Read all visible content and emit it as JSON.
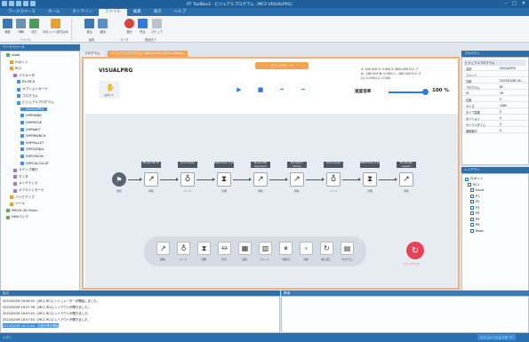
{
  "titlebar": {
    "title": "RT ToolBox3 - ビジュアルプログラム（MC1:VISUALPRG）"
  },
  "menu": [
    {
      "label": "ワークスペース"
    },
    {
      "label": "ホーム"
    },
    {
      "label": "オンライン"
    },
    {
      "label": "ファイル"
    },
    {
      "label": "編集"
    },
    {
      "label": "表示"
    },
    {
      "label": "ヘルプ"
    }
  ],
  "ribbon": {
    "buttons": [
      {
        "label": "保存"
      },
      {
        "label": "印刷"
      },
      {
        "label": "出力"
      },
      {
        "label": "ロボットへ書き込み"
      },
      {
        "label": "書込"
      },
      {
        "label": "読出"
      },
      {
        "label": "実行"
      },
      {
        "label": "停止"
      },
      {
        "label": "ステップ"
      }
    ],
    "groups": [
      "ファイル",
      "編集",
      "モニタ",
      "開始終了"
    ]
  },
  "workspace": {
    "header": "ワークスペース",
    "rows": [
      {
        "label": "robot",
        "indent": 1
      },
      {
        "label": "ロボット",
        "indent": 2
      },
      {
        "label": "RC1",
        "indent": 2
      },
      {
        "label": "パラメータ",
        "indent": 3
      },
      {
        "label": "RV-FR-D",
        "indent": 4
      },
      {
        "label": "オプションカード",
        "indent": 4
      },
      {
        "label": "プログラム",
        "indent": 4
      },
      {
        "label": "ビジュアルプログラム",
        "indent": 4
      },
      {
        "label": "VISUALPRG",
        "indent": 5,
        "selected": true
      },
      {
        "label": "VHPHAND",
        "indent": 5
      },
      {
        "label": "VHPMOVE",
        "indent": 5
      },
      {
        "label": "VHPWAIT",
        "indent": 5
      },
      {
        "label": "VHPBRANCH",
        "indent": 5
      },
      {
        "label": "VHPPALLET",
        "indent": 5
      },
      {
        "label": "VHPSIGNAL",
        "indent": 5
      },
      {
        "label": "VHPVISION",
        "indent": 5
      },
      {
        "label": "VHPCALCULAT",
        "indent": 5
      },
      {
        "label": "ステップ実行",
        "indent": 3
      },
      {
        "label": "モニタ",
        "indent": 3
      },
      {
        "label": "メンテナンス",
        "indent": 3
      },
      {
        "label": "オフラインモード",
        "indent": 3
      },
      {
        "label": "バックアップ",
        "indent": 2
      },
      {
        "label": "ツール",
        "indent": 2
      },
      {
        "label": "MELFA 3D Vision",
        "indent": 1
      },
      {
        "label": "HMI/バンク",
        "indent": 1
      }
    ]
  },
  "tabs": [
    {
      "label": "プログラム"
    },
    {
      "label": "ビジュアルプログラム VISUALPRG (MC1:Offline)"
    }
  ],
  "editor": {
    "program_name": "VISUALPRG",
    "mode_tag": "ステップモード",
    "robot_card_label": "ロボット",
    "coords": [
      "X: 400.000  Y: 0.000  Z: 800.000  FL1: 7",
      "A: -180.000  B: 0.000  C: -180.000  FL2: 0",
      "L1: 0.000  L2: 0.000"
    ],
    "speed_label": "速度倍率",
    "speed_value": "100 %",
    "speed_fraction": 1.0
  },
  "flow": {
    "start_label": "開始",
    "nodes": [
      {
        "title": "Move(LIN) P1",
        "caption": "移動",
        "glyph": "↗"
      },
      {
        "title": "Hand Open",
        "caption": "ハンド",
        "glyph": "♁"
      },
      {
        "title": "Wait(Time) 0.5s",
        "caption": "待機",
        "glyph": "⧗"
      },
      {
        "title": "Move(LIN) Approach",
        "caption": "移動",
        "glyph": "↗"
      },
      {
        "title": "Move(JNT) PickUp",
        "caption": "移動",
        "glyph": "↗"
      },
      {
        "title": "Hand Close",
        "caption": "ハンド",
        "glyph": "♁"
      },
      {
        "title": "Wait(Time) 0.5s",
        "caption": "待機",
        "glyph": "⧗"
      },
      {
        "title": "Move(LIN) Depart",
        "caption": "移動",
        "glyph": "↗"
      }
    ]
  },
  "palette": [
    {
      "label": "移動",
      "glyph": "↗"
    },
    {
      "label": "ハンド",
      "glyph": "♁"
    },
    {
      "label": "待機",
      "glyph": "⧗"
    },
    {
      "label": "信号",
      "glyph": "⏛"
    },
    {
      "label": "演算",
      "glyph": "▦"
    },
    {
      "label": "パレット",
      "glyph": "▥"
    },
    {
      "label": "一時停止",
      "glyph": "⏸"
    },
    {
      "label": "分岐",
      "glyph": "‹"
    },
    {
      "label": "繰り返し",
      "glyph": "↻"
    },
    {
      "label": "プログラム",
      "glyph": "▤"
    }
  ],
  "run_button": {
    "label": "プレイバック"
  },
  "properties": {
    "header": "プロパティ",
    "subheader": "ビジュアルプログラム",
    "rows": [
      {
        "k": "名前",
        "v": "VISUALPRG"
      },
      {
        "k": "コメント",
        "v": ""
      },
      {
        "k": "日時",
        "v": "2023/02/08 16:..."
      },
      {
        "k": "プログラム",
        "v": "BC"
      },
      {
        "k": "ID",
        "v": "16"
      },
      {
        "k": "位置",
        "v": "0"
      },
      {
        "k": "サイズ",
        "v": "1080"
      },
      {
        "k": "タイプ変数",
        "v": "0"
      },
      {
        "k": "ポジション",
        "v": "0"
      },
      {
        "k": "サイクルタイム",
        "v": "0"
      },
      {
        "k": "連続実行",
        "v": "0"
      }
    ]
  },
  "layout_panel": {
    "header": "レイアウト",
    "rows": [
      {
        "label": "ロボット"
      },
      {
        "label": "RC1"
      },
      {
        "label": "hand"
      },
      {
        "label": "P1"
      },
      {
        "label": "P2"
      },
      {
        "label": "P3"
      },
      {
        "label": "P4"
      },
      {
        "label": "P5"
      },
      {
        "label": "P6"
      },
      {
        "label": "Base"
      }
    ]
  },
  "output": {
    "header": "出力",
    "header2": "検索",
    "rows": [
      {
        "text": "2023/02/08 16:06:55 : [MC1 RC1] シミュレーターが開始しました。"
      },
      {
        "text": "2023/02/08 16:07:38 : [MC1 RC1] レイアウトが開きました。"
      },
      {
        "text": "2023/02/08 16:07:42 : [MC1 RC1] レイアウトが開きました。"
      },
      {
        "text": "2023/02/08 16:07:50 : [MC1 RC1] レイアウトが開きました。"
      },
      {
        "text": "2023/02/08 16:11:48 : 手動作業を開始",
        "selected": true
      }
    ]
  },
  "statusbar": {
    "left": "レディ",
    "right": "シミュレーションモード"
  }
}
